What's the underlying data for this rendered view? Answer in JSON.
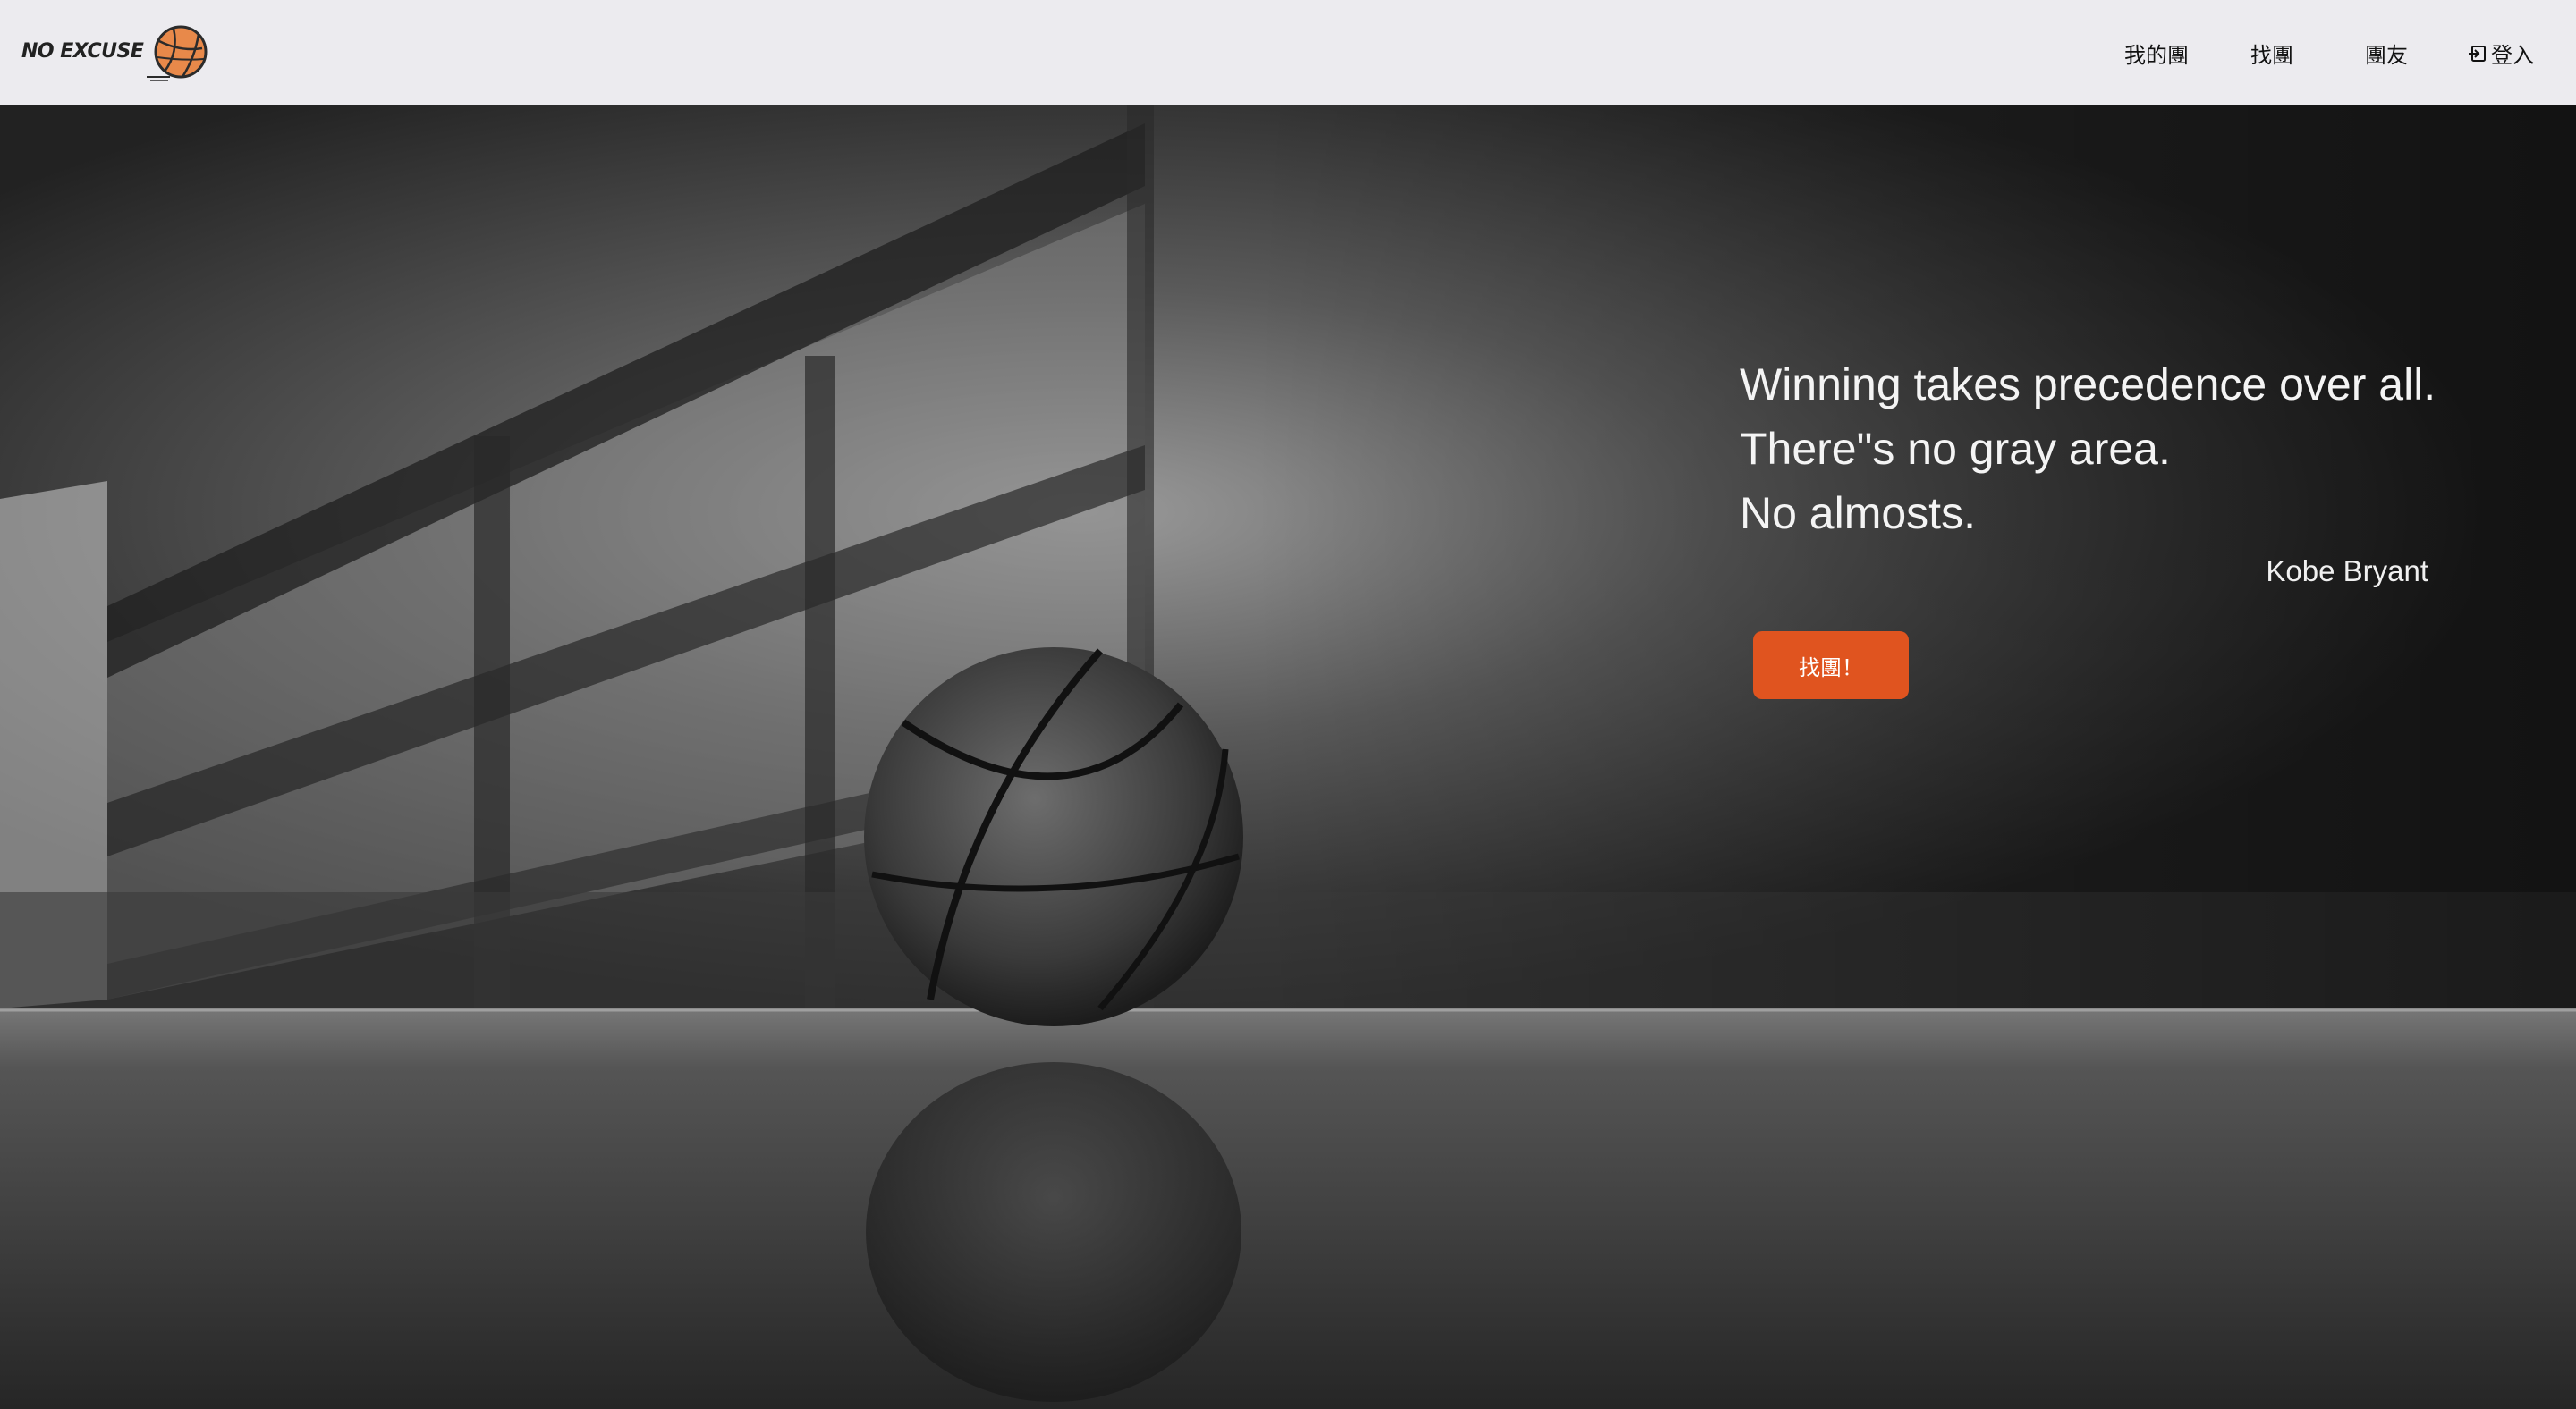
{
  "brand": {
    "name": "NO EXCUSE",
    "logo_icon": "basketball-icon",
    "ball_color": "#e8894a"
  },
  "nav": {
    "my_team": "我的團",
    "find_team": "找團",
    "buddies": "團友",
    "login": "登入",
    "login_icon": "sign-in-icon"
  },
  "hero": {
    "quote_lines": [
      "Winning takes precedence over all.",
      "There\"s no gray area.",
      "No almosts."
    ],
    "author": "Kobe Bryant",
    "cta_label": "找團！",
    "cta_color": "#e0541f",
    "background_subject": "basketball-on-court-photo"
  },
  "colors": {
    "header_bg": "#ecebef",
    "accent": "#e0541f"
  }
}
